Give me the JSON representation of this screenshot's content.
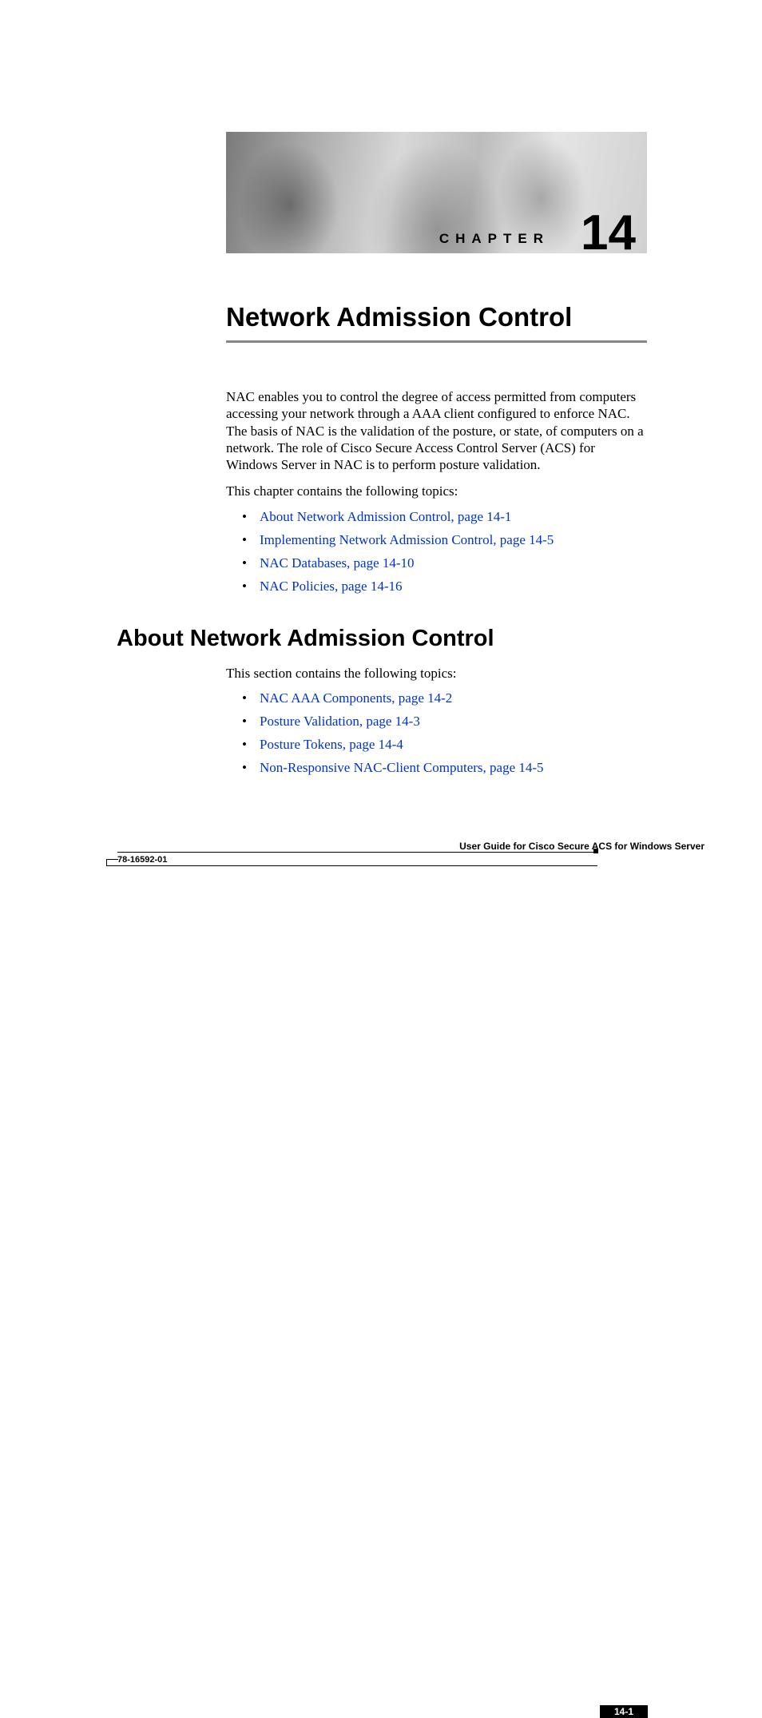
{
  "chapter": {
    "label": "CHAPTER",
    "number": "14"
  },
  "title": "Network Admission Control",
  "intro": "NAC enables you to control the degree of access permitted from computers accessing your network through a AAA client configured to enforce NAC. The basis of NAC is the validation of the posture, or state, of computers on a network. The role of Cisco Secure Access Control Server (ACS) for Windows Server in NAC is to perform posture validation.",
  "topics_intro": "This chapter contains the following topics:",
  "topics": [
    "About Network Admission Control, page 14-1",
    "Implementing Network Admission Control, page 14-5",
    "NAC Databases, page 14-10",
    "NAC Policies, page 14-16"
  ],
  "section": {
    "title": "About Network Admission Control",
    "intro": "This section contains the following topics:",
    "topics": [
      "NAC AAA Components, page 14-2",
      "Posture Validation, page 14-3",
      "Posture Tokens, page 14-4",
      "Non-Responsive NAC-Client Computers, page 14-5"
    ]
  },
  "footer": {
    "guide": "User Guide for Cisco Secure ACS for Windows Server",
    "docnum": "78-16592-01",
    "pagenum": "14-1"
  }
}
